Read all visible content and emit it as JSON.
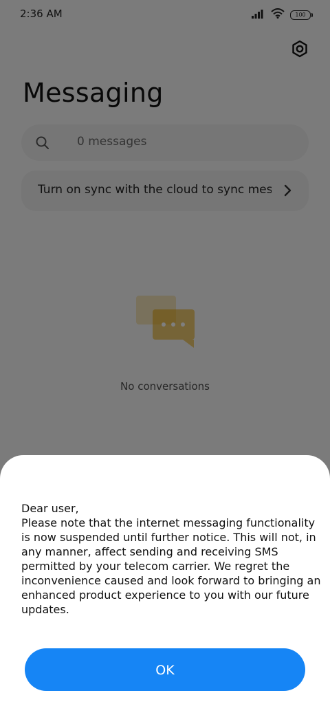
{
  "status_bar": {
    "time": "2:36 AM",
    "battery": "100"
  },
  "header": {
    "title": "Messaging",
    "settings_icon": "gear-icon"
  },
  "search": {
    "placeholder": "0 messages",
    "icon": "search-icon"
  },
  "sync_card": {
    "text": "Turn on sync with the cloud to sync messages",
    "icon": "chevron-right-icon"
  },
  "empty_state": {
    "icon": "conversation-bubbles-icon",
    "text": "No conversations",
    "bubble_color": "#e5a300"
  },
  "dialog": {
    "greeting": "Dear user,",
    "message": "Please note that the internet messaging functionality is now suspended until further notice. This will not, in any manner, affect sending and receiving SMS permitted by your telecom carrier. We regret the inconvenience caused and look forward to bringing an enhanced product experience to you with our future updates.",
    "ok_label": "OK",
    "button_color": "#1685f5"
  }
}
